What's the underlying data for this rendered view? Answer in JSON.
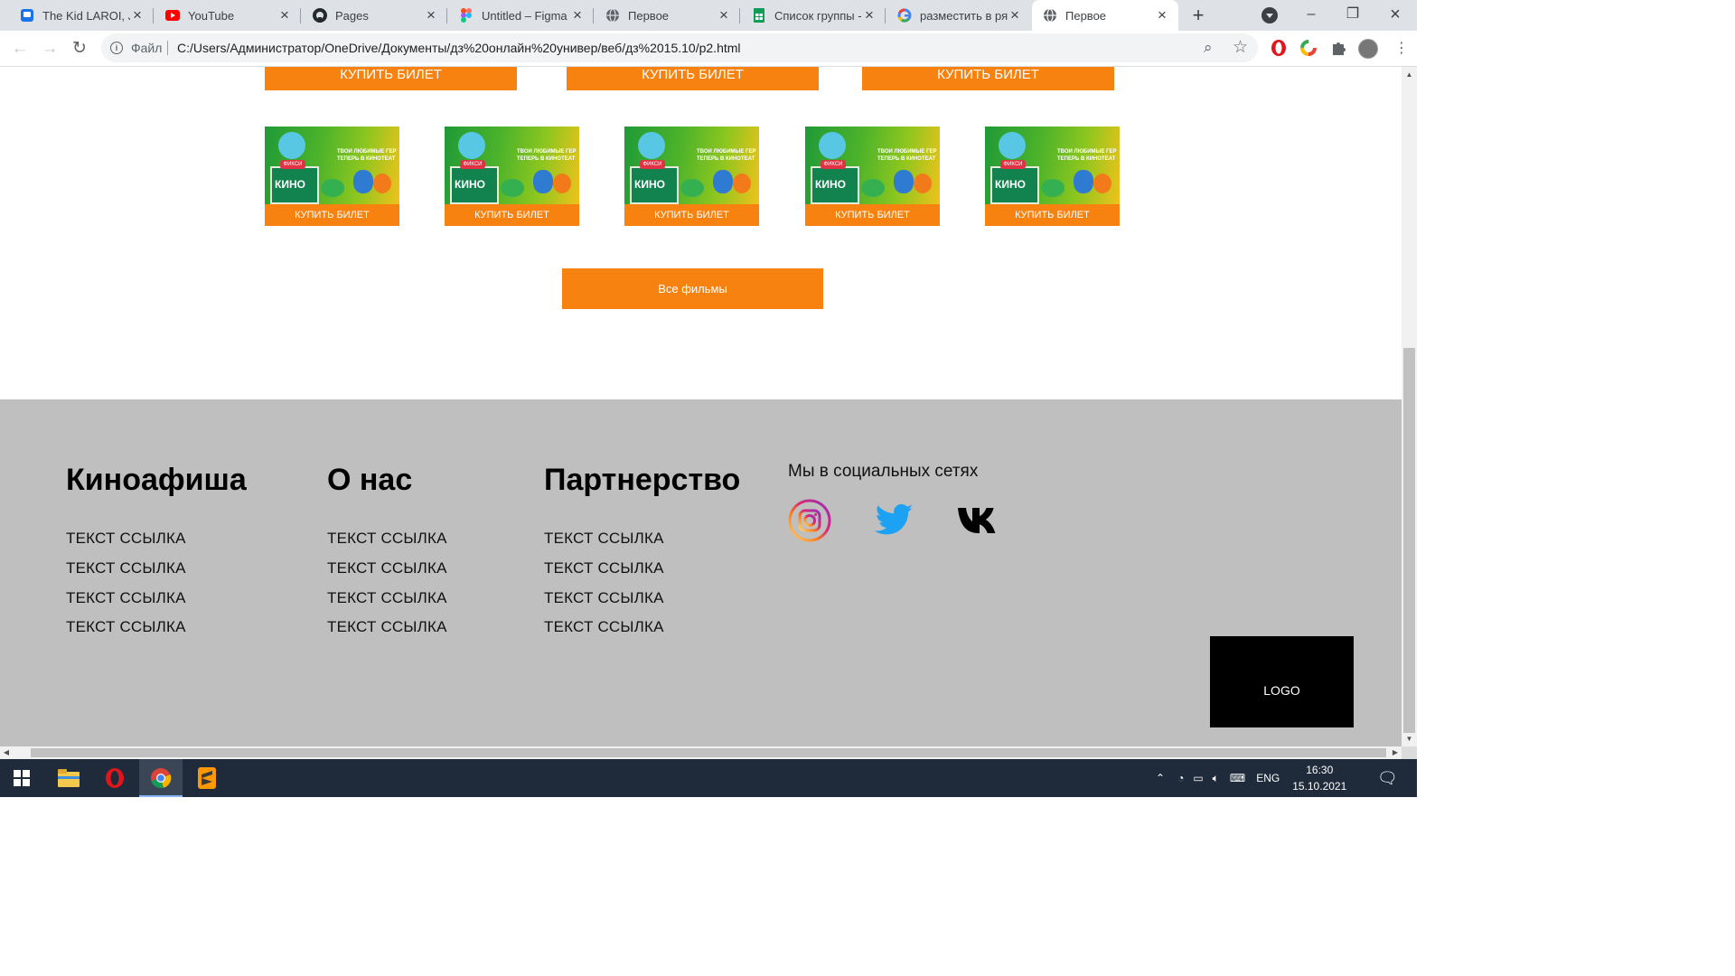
{
  "browser": {
    "tabs": [
      {
        "title": "The Kid LAROI, Ju",
        "icon": "chat-icon",
        "active": false
      },
      {
        "title": "YouTube",
        "icon": "youtube-icon",
        "active": false
      },
      {
        "title": "Pages",
        "icon": "github-icon",
        "active": false
      },
      {
        "title": "Untitled – Figma",
        "icon": "figma-icon",
        "active": false
      },
      {
        "title": "Первое",
        "icon": "globe-icon",
        "active": false
      },
      {
        "title": "Список группы -",
        "icon": "sheets-icon",
        "active": false
      },
      {
        "title": "разместить в ряд",
        "icon": "google-icon",
        "active": false
      },
      {
        "title": "Первое",
        "icon": "globe-icon",
        "active": true
      }
    ],
    "address": {
      "scheme_label": "Файл",
      "url": "C:/Users/Администратор/OneDrive/Документы/дз%20онлайн%20универ/веб/дз%2015.10/p2.html"
    }
  },
  "page": {
    "top_buy_buttons": [
      "КУПИТЬ БИЛЕТ",
      "КУПИТЬ БИЛЕТ",
      "КУПИТЬ БИЛЕТ"
    ],
    "movie_cards": [
      {
        "poster_title": "КИНО",
        "poster_tag": "ФИКСИ",
        "poster_slogan_1": "ТВОИ ЛЮБИМЫЕ ГЕР",
        "poster_slogan_2": "ТЕПЕРЬ В КИНОТЕАТ",
        "buy_label": "КУПИТЬ БИЛЕТ"
      },
      {
        "poster_title": "КИНО",
        "poster_tag": "ФИКСИ",
        "poster_slogan_1": "ТВОИ ЛЮБИМЫЕ ГЕР",
        "poster_slogan_2": "ТЕПЕРЬ В КИНОТЕАТ",
        "buy_label": "КУПИТЬ БИЛЕТ"
      },
      {
        "poster_title": "КИНО",
        "poster_tag": "ФИКСИ",
        "poster_slogan_1": "ТВОИ ЛЮБИМЫЕ ГЕР",
        "poster_slogan_2": "ТЕПЕРЬ В КИНОТЕАТ",
        "buy_label": "КУПИТЬ БИЛЕТ"
      },
      {
        "poster_title": "КИНО",
        "poster_tag": "ФИКСИ",
        "poster_slogan_1": "ТВОИ ЛЮБИМЫЕ ГЕР",
        "poster_slogan_2": "ТЕПЕРЬ В КИНОТЕАТ",
        "buy_label": "КУПИТЬ БИЛЕТ"
      },
      {
        "poster_title": "КИНО",
        "poster_tag": "ФИКСИ",
        "poster_slogan_1": "ТВОИ ЛЮБИМЫЕ ГЕР",
        "poster_slogan_2": "ТЕПЕРЬ В КИНОТЕАТ",
        "buy_label": "КУПИТЬ БИЛЕТ"
      }
    ],
    "all_movies_label": "Все фильмы",
    "footer": {
      "columns": [
        {
          "title": "Киноафиша",
          "links": [
            "ТЕКСТ ССЫЛКА",
            "ТЕКСТ ССЫЛКА",
            "ТЕКСТ ССЫЛКА",
            "ТЕКСТ ССЫЛКА"
          ]
        },
        {
          "title": "О нас",
          "links": [
            "ТЕКСТ ССЫЛКА",
            "ТЕКСТ ССЫЛКА",
            "ТЕКСТ ССЫЛКА",
            "ТЕКСТ ССЫЛКА"
          ]
        },
        {
          "title": "Партнерство",
          "links": [
            "ТЕКСТ ССЫЛКА",
            "ТЕКСТ ССЫЛКА",
            "ТЕКСТ ССЫЛКА",
            "ТЕКСТ ССЫЛКА"
          ]
        }
      ],
      "social_title": "Мы в социальных сетях",
      "social_icons": [
        "instagram-icon",
        "twitter-icon",
        "vk-icon"
      ],
      "logo_text": "LOGO"
    }
  },
  "taskbar": {
    "apps": [
      "file-explorer-icon",
      "opera-icon",
      "chrome-icon",
      "sublime-text-icon"
    ],
    "language": "ENG",
    "time": "16:30",
    "date": "15.10.2021"
  },
  "colors": {
    "accent_orange": "#f7820f",
    "footer_bg": "#bfbfbf",
    "taskbar_bg": "#1f2b3a"
  }
}
